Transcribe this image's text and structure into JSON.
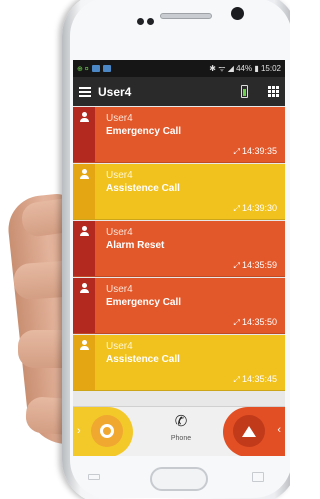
{
  "statusbar": {
    "left_icons": "⊕ ¤",
    "right_text": "✱ ᯤ ◢ 44% ▮ 15:02"
  },
  "appbar": {
    "title": "User4"
  },
  "cards": [
    {
      "user": "User4",
      "event": "Emergency Call",
      "time": "14:39:35",
      "color": "red"
    },
    {
      "user": "User4",
      "event": "Assistence Call",
      "time": "14:39:30",
      "color": "yellow"
    },
    {
      "user": "User4",
      "event": "Alarm Reset",
      "time": "14:35:59",
      "color": "red"
    },
    {
      "user": "User4",
      "event": "Emergency Call",
      "time": "14:35:50",
      "color": "red"
    },
    {
      "user": "User4",
      "event": "Assistence Call",
      "time": "14:35:45",
      "color": "yellow"
    }
  ],
  "bottomnav": {
    "phone_label": "Phone",
    "left_arrow": "›",
    "right_arrow": "‹"
  },
  "colors": {
    "red": "#e2582a",
    "yellow": "#f1c21e",
    "appbar": "#2a2a2a"
  },
  "icons": {
    "menu": "menu-icon",
    "grid": "grid-icon",
    "battery": "battery-icon",
    "person": "person-icon",
    "phone": "phone-icon",
    "assist": "circle-button-icon",
    "alarm": "warning-triangle-icon"
  }
}
